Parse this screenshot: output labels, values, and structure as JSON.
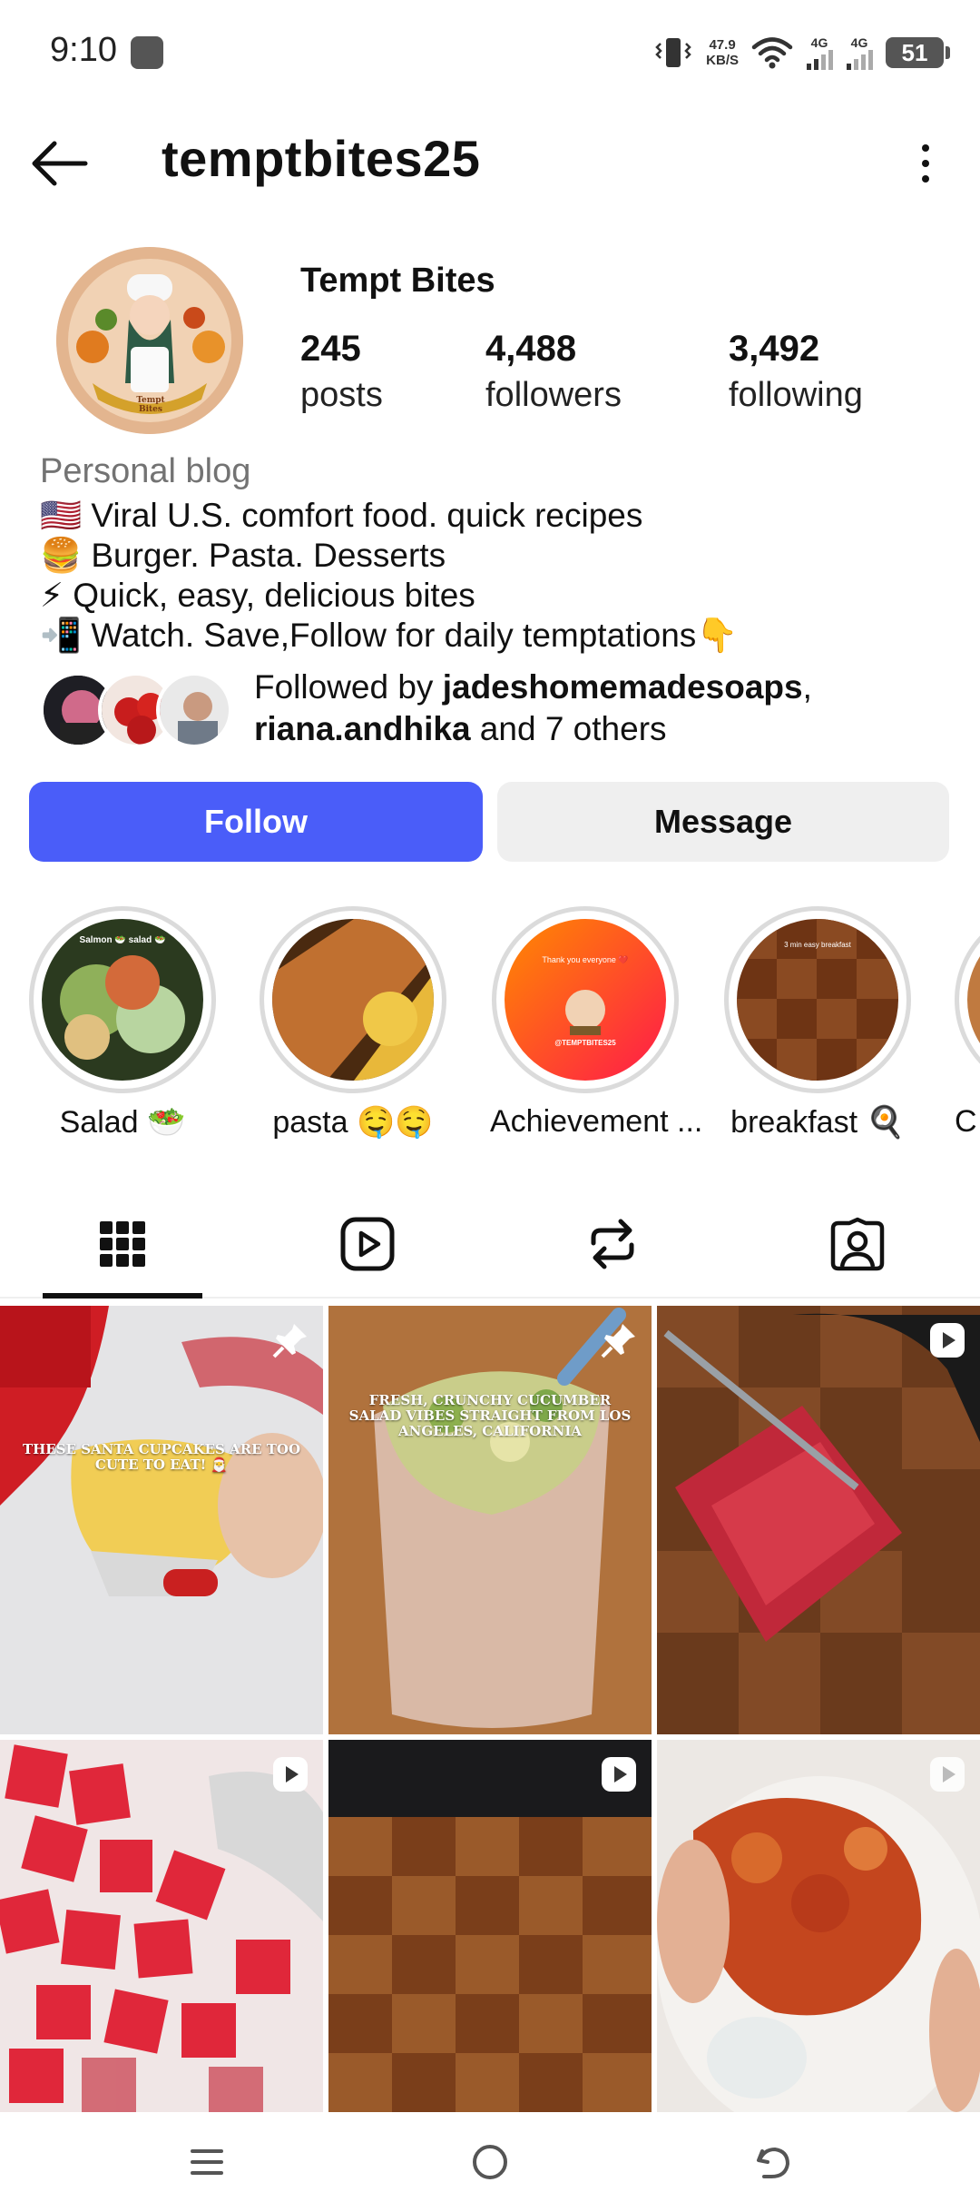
{
  "status_bar": {
    "time": "9:10",
    "net_speed_value": "47.9",
    "net_speed_unit": "KB/S",
    "sim1_label": "4G",
    "sim2_label": "4G",
    "battery": "51"
  },
  "header": {
    "username": "temptbites25",
    "back_icon": "arrow-left-icon",
    "more_icon": "more-vertical-icon"
  },
  "profile": {
    "display_name": "Tempt Bites",
    "stats": [
      {
        "value": "245",
        "label": "posts"
      },
      {
        "value": "4,488",
        "label": "followers"
      },
      {
        "value": "3,492",
        "label": "following"
      }
    ],
    "category": "Personal blog",
    "bio": [
      "🇺🇸 Viral U.S. comfort food. quick recipes",
      "🍔 Burger. Pasta. Desserts",
      "⚡ Quick, easy, delicious bites",
      "📲 Watch. Save,Follow for daily temptations👇"
    ],
    "followed_by": {
      "prefix": "Followed by ",
      "user1": "jadeshomemadesoaps",
      "sep": ",",
      "user2": "riana.andhika",
      "suffix": " and 7 others"
    }
  },
  "actions": {
    "follow": "Follow",
    "message": "Message"
  },
  "highlights": [
    {
      "label": "Salad 🥗",
      "color": "#6a8a3a"
    },
    {
      "label": "pasta 🤤🤤",
      "color": "#c98a3c"
    },
    {
      "label": "Achievement ...",
      "color": "#ff4a1a"
    },
    {
      "label": "breakfast 🍳",
      "color": "#7a3a1a"
    },
    {
      "label": "C",
      "color": "#c07a40"
    }
  ],
  "tabs": [
    {
      "icon": "grid-icon",
      "active": true
    },
    {
      "icon": "reels-icon",
      "active": false
    },
    {
      "icon": "repost-icon",
      "active": false
    },
    {
      "icon": "tagged-icon",
      "active": false
    }
  ],
  "posts": [
    {
      "caption": "THESE SANTA CUPCAKES ARE TOO CUTE TO EAT! 🎅",
      "badge": "pin-icon"
    },
    {
      "caption": "FRESH, CRUNCHY CUCUMBER SALAD VIBES STRAIGHT FROM LOS ANGELES, CALIFORNIA",
      "badge": "pin-icon"
    },
    {
      "caption": "",
      "badge": "reel-icon"
    },
    {
      "caption": "",
      "badge": "reel-icon"
    },
    {
      "caption": "",
      "badge": "reel-icon"
    },
    {
      "caption": "",
      "badge": "reel-icon"
    }
  ],
  "highlight_captions": {
    "salad": "Salmon 🥗 salad 🥗",
    "achievement": "Thank you everyone ❤️",
    "achievement_tag": "@TEMPTBITES25",
    "breakfast": "3 min easy breakfast"
  },
  "avatar_banner": "Tempt Bites",
  "colors": {
    "follow_button": "#4a5df9",
    "message_button": "#efefef",
    "highlight_ring": "#dbdbdb"
  },
  "navbar": {
    "menu_icon": "menu-icon",
    "home_icon": "home-circle-icon",
    "back_icon": "back-gesture-icon"
  }
}
